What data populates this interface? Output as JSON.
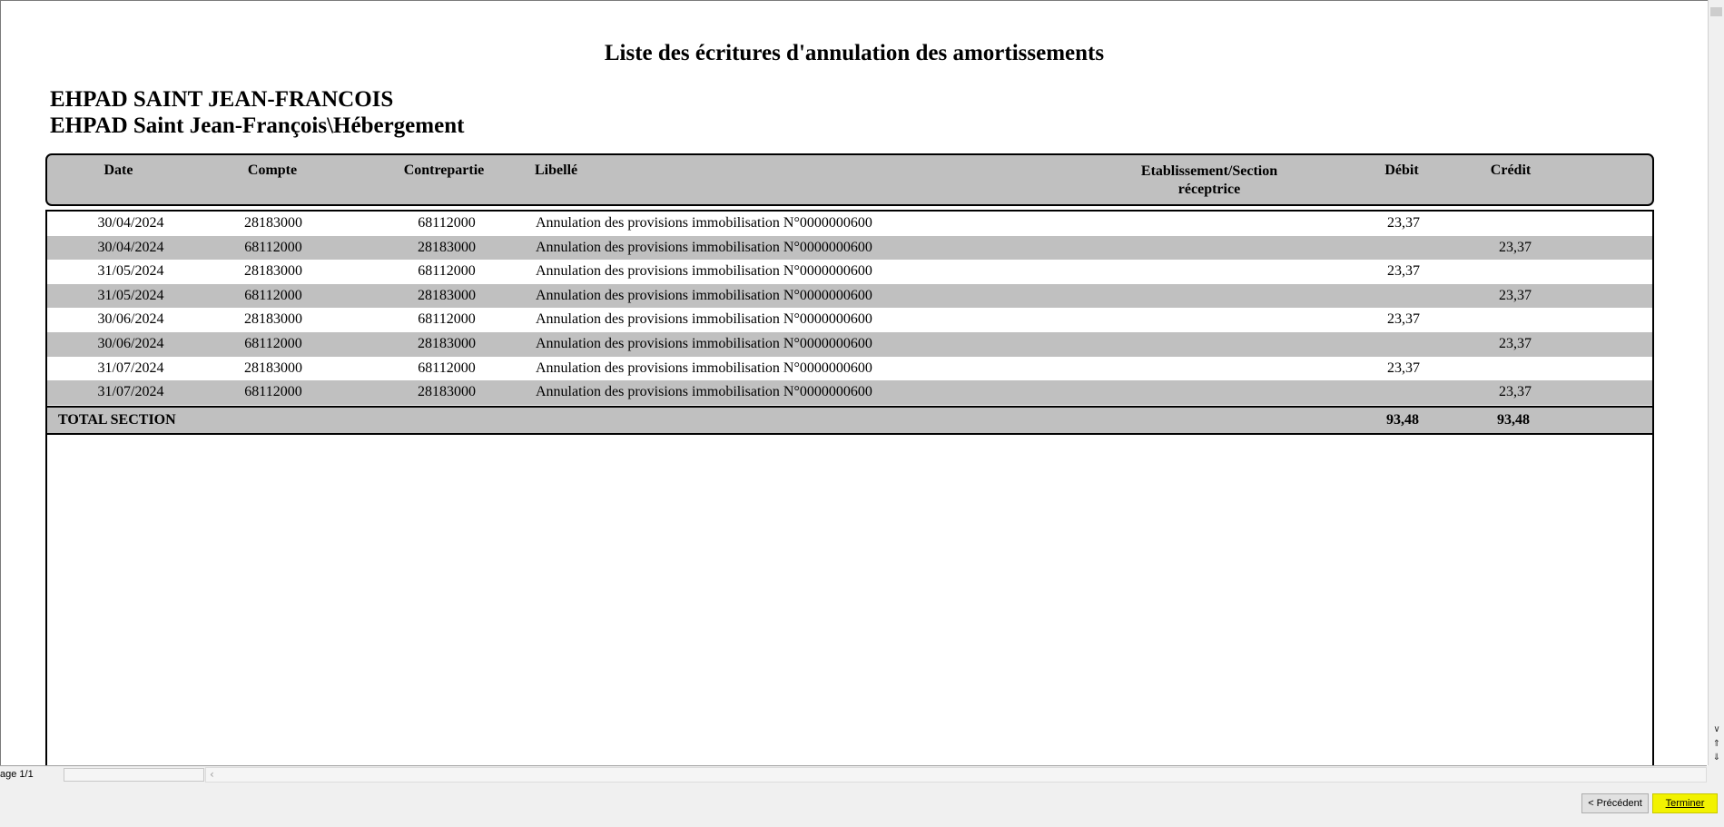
{
  "report": {
    "title": "Liste des écritures d'annulation des amortissements",
    "establishment": "EHPAD SAINT JEAN-FRANCOIS",
    "section": "EHPAD Saint Jean-François\\Hébergement"
  },
  "columns": {
    "date": "Date",
    "compte": "Compte",
    "contrepartie": "Contrepartie",
    "libelle": "Libellé",
    "etab_line1": "Etablissement/Section",
    "etab_line2": "réceptrice",
    "debit": "Débit",
    "credit": "Crédit"
  },
  "rows": [
    {
      "date": "30/04/2024",
      "compte": "28183000",
      "contrepartie": "68112000",
      "libelle": "Annulation des provisions immobilisation N°0000000600",
      "debit": "23,37",
      "credit": ""
    },
    {
      "date": "30/04/2024",
      "compte": "68112000",
      "contrepartie": "28183000",
      "libelle": "Annulation des provisions immobilisation N°0000000600",
      "debit": "",
      "credit": "23,37"
    },
    {
      "date": "31/05/2024",
      "compte": "28183000",
      "contrepartie": "68112000",
      "libelle": "Annulation des provisions immobilisation N°0000000600",
      "debit": "23,37",
      "credit": ""
    },
    {
      "date": "31/05/2024",
      "compte": "68112000",
      "contrepartie": "28183000",
      "libelle": "Annulation des provisions immobilisation N°0000000600",
      "debit": "",
      "credit": "23,37"
    },
    {
      "date": "30/06/2024",
      "compte": "28183000",
      "contrepartie": "68112000",
      "libelle": "Annulation des provisions immobilisation N°0000000600",
      "debit": "23,37",
      "credit": ""
    },
    {
      "date": "30/06/2024",
      "compte": "68112000",
      "contrepartie": "28183000",
      "libelle": "Annulation des provisions immobilisation N°0000000600",
      "debit": "",
      "credit": "23,37"
    },
    {
      "date": "31/07/2024",
      "compte": "28183000",
      "contrepartie": "68112000",
      "libelle": "Annulation des provisions immobilisation N°0000000600",
      "debit": "23,37",
      "credit": ""
    },
    {
      "date": "31/07/2024",
      "compte": "68112000",
      "contrepartie": "28183000",
      "libelle": "Annulation des provisions immobilisation N°0000000600",
      "debit": "",
      "credit": "23,37"
    }
  ],
  "total": {
    "label": "TOTAL SECTION",
    "debit": "93,48",
    "credit": "93,48"
  },
  "status": {
    "page": "age 1/1"
  },
  "buttons": {
    "prev": "< Précédent",
    "finish": "Terminer"
  },
  "colors": {
    "row_shade": "#c0c0c0",
    "finish_highlight": "#f2f200"
  },
  "icons": [
    "scroll-up-arrow-icon",
    "scroll-down-arrow-icon",
    "page-up-icon",
    "page-down-icon",
    "scroll-left-arrow-icon"
  ]
}
